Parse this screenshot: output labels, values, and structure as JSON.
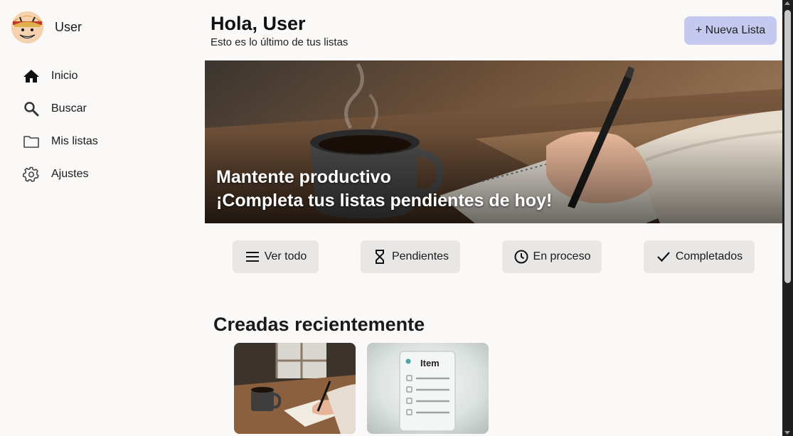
{
  "user": {
    "name": "User"
  },
  "sidebar": {
    "items": [
      {
        "label": "Inicio",
        "icon": "home-icon"
      },
      {
        "label": "Buscar",
        "icon": "search-icon"
      },
      {
        "label": "Mis listas",
        "icon": "folder-icon"
      },
      {
        "label": "Ajustes",
        "icon": "gear-icon"
      }
    ]
  },
  "header": {
    "greeting": "Hola, User",
    "subtitle": "Esto es lo último de tus listas",
    "new_list_label": "+ Nueva Lista"
  },
  "hero": {
    "line1": "Mantente productivo",
    "line2": "¡Completa tus listas pendientes de hoy!"
  },
  "filters": [
    {
      "label": "Ver todo",
      "icon": "menu-icon"
    },
    {
      "label": "Pendientes",
      "icon": "hourglass-icon"
    },
    {
      "label": "En proceso",
      "icon": "clock-icon"
    },
    {
      "label": "Completados",
      "icon": "check-icon"
    }
  ],
  "recent": {
    "title": "Creadas recientemente",
    "cards": [
      {
        "image": "coffee-writing-image"
      },
      {
        "image": "checklist-item-image",
        "text": "Item"
      }
    ]
  },
  "colors": {
    "background": "#faf9f7",
    "accent_button": "#c5c9f0",
    "filter_button": "#e8e7e5"
  }
}
